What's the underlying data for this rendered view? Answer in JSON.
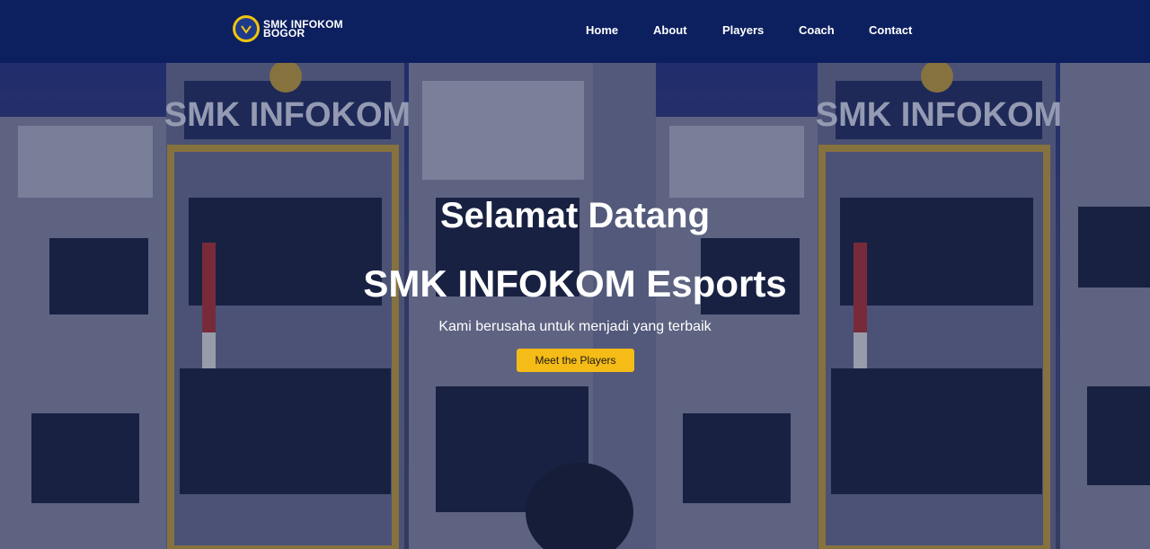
{
  "nav": {
    "brand_line1": "SMK INFOKOM",
    "brand_line2": "BOGOR",
    "links": [
      {
        "label": "Home"
      },
      {
        "label": "About"
      },
      {
        "label": "Players"
      },
      {
        "label": "Coach"
      },
      {
        "label": "Contact"
      }
    ]
  },
  "hero": {
    "title": "Selamat Datang",
    "subtitle": "SMK INFOKOM Esports",
    "tagline": "Kami berusaha untuk menjadi yang terbaik",
    "cta_label": "Meet the Players",
    "building_sign": "SMK INFOKOM"
  },
  "colors": {
    "navbar": "#0c1f5e",
    "accent": "#f5bb16",
    "text": "#ffffff"
  }
}
